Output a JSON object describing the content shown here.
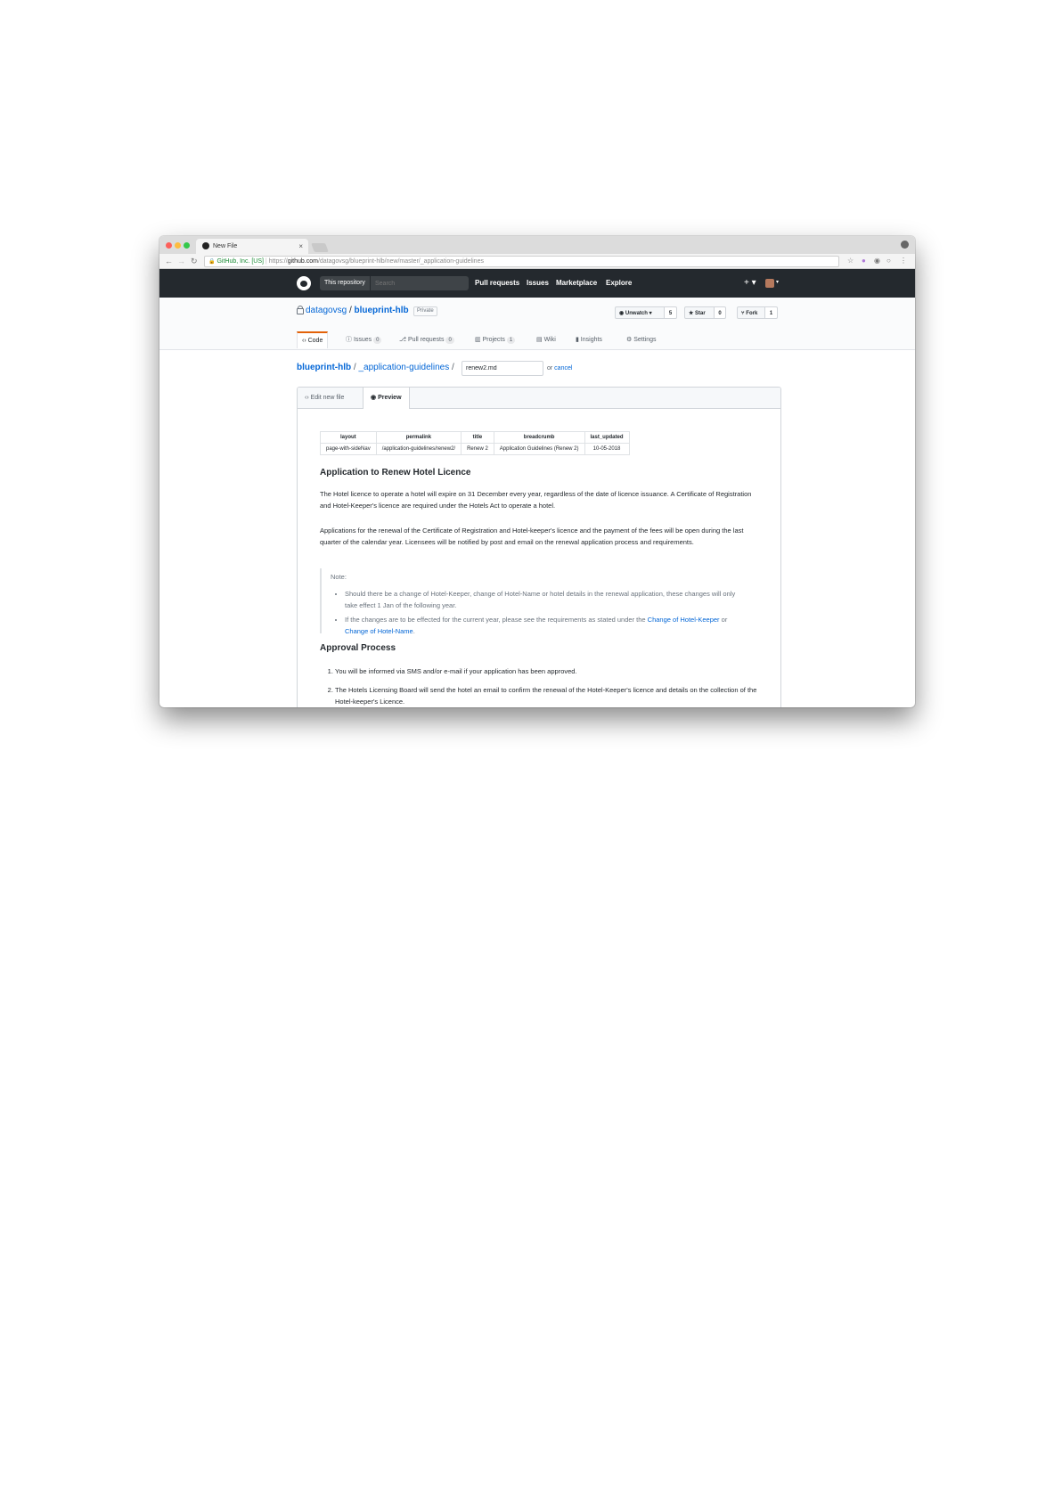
{
  "browser": {
    "tab_title": "New File",
    "tab_close": "×",
    "omnibox": {
      "lock": "🔒",
      "secure_label": "GitHub, Inc. [US]",
      "url_scheme": "https://",
      "url_host": "github.com",
      "url_path": "/datagovsg/blueprint-hlb/new/master/_application-guidelines"
    }
  },
  "github_header": {
    "scope_label": "This repository",
    "search_placeholder": "Search",
    "nav": [
      "Pull requests",
      "Issues",
      "Marketplace",
      "Explore"
    ],
    "plus": "+ ▾",
    "avatar_caret": "▾"
  },
  "repo": {
    "owner": "datagovsg",
    "separator": "/",
    "name": "blueprint-hlb",
    "visibility": "Private",
    "actions": {
      "watch_label": "Unwatch ▾",
      "watch_count": "5",
      "star_label": "Star",
      "star_count": "0",
      "fork_label": "Fork",
      "fork_count": "1"
    },
    "nav": {
      "code": "Code",
      "issues": "Issues",
      "issues_count": "0",
      "pulls": "Pull requests",
      "pulls_count": "0",
      "projects": "Projects",
      "projects_count": "1",
      "wiki": "Wiki",
      "insights": "Insights",
      "settings": "Settings"
    }
  },
  "file_path": {
    "repo": "blueprint-hlb",
    "sep1": " / ",
    "dir": "_application-guidelines",
    "sep2": " /",
    "filename": "renew2.md",
    "or": "or ",
    "cancel": "cancel"
  },
  "editor": {
    "tab_edit": "Edit new file",
    "tab_preview": "Preview"
  },
  "preview": {
    "frontmatter": {
      "headers": [
        "layout",
        "permalink",
        "title",
        "breadcrumb",
        "last_updated"
      ],
      "row": [
        "page-with-sideNav",
        "/application-guidelines/renew2/",
        "Renew 2",
        "Application Guidelines (Renew 2)",
        "10-05-2018"
      ]
    },
    "h1": "Application to Renew Hotel Licence",
    "p1": "The Hotel licence to operate a hotel will expire on 31 December every year, regardless of the date of licence issuance. A Certificate of Registration and Hotel-Keeper's licence are required under the Hotels Act to operate a hotel.",
    "p2": "Applications for the renewal of the Certificate of Registration and Hotel-keeper's licence and the payment of the fees will be open during the last quarter of the calendar year. Licensees will be notified by post and email on the renewal application process and requirements.",
    "note_label": "Note:",
    "note_item1": "Should there be a change of Hotel-Keeper, change of Hotel-Name or hotel details in the renewal application, these changes will only take effect 1 Jan of the following year.",
    "note_item2_text": "If the changes are to be effected for the current year, please see the requirements as stated under the ",
    "note_item2_link1": "Change of Hotel-Keeper",
    "note_item2_or": " or ",
    "note_item2_link2": "Change of Hotel-Name",
    "note_item2_end": ".",
    "h2": "Approval Process",
    "steps": [
      "You will be informed via SMS and/or e-mail if your application has been approved.",
      "The Hotels Licensing Board will send the hotel an email to confirm the renewal of the Hotel-Keeper's licence and details on the collection of the Hotel-keeper's Licence."
    ]
  }
}
